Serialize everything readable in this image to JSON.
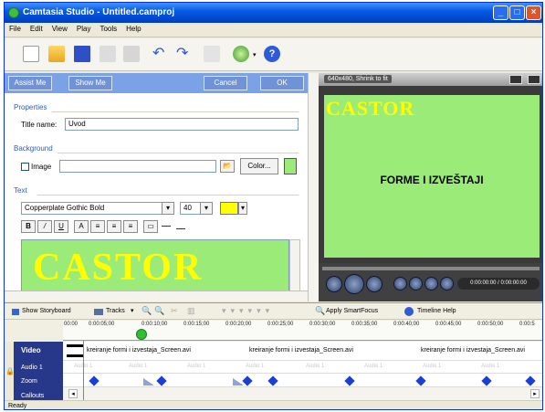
{
  "window": {
    "title": "Camtasia Studio - Untitled.camproj"
  },
  "menu": [
    "File",
    "Edit",
    "View",
    "Play",
    "Tools",
    "Help"
  ],
  "toolbar": {
    "icons": [
      "new-icon",
      "open-folder-icon",
      "save-icon",
      "import-icon",
      "produce-icon",
      "undo-icon",
      "redo-icon",
      "cut-icon",
      "record-icon",
      "help-icon"
    ]
  },
  "panel": {
    "assist_label": "Assist Me",
    "show_label": "Show Me",
    "cancel_label": "Cancel",
    "ok_label": "OK",
    "properties_heading": "Properties",
    "title_name_label": "Title name:",
    "title_name_value": "Uvod",
    "background_heading": "Background",
    "image_label": "Image",
    "color_button": "Color...",
    "text_heading": "Text",
    "font_value": "Copperplate Gothic Bold",
    "font_size": "40",
    "preview_text": "CASTOR"
  },
  "preview": {
    "resolution_label": "640x480, Shrink to fit",
    "logo_text": "CASTOR",
    "caption": "FORME I IZVEŠTAJI",
    "time_display": "0:00:00:00 / 0:00:00:00",
    "background_color": "#9aeb77"
  },
  "timeline": {
    "storyboard_label": "Show Storyboard",
    "tracks_label": "Tracks",
    "smartfocus_label": "Apply SmartFocus",
    "help_label": "Timeline Help",
    "ruler": [
      "00:00",
      "0:00:05;00",
      "0:00:10;00",
      "0:00:15;00",
      "0:00:20;00",
      "0:00:25;00",
      "0:00:30;00",
      "0:00:35;00",
      "0:00:40;00",
      "0:00:45;00",
      "0:00:50;00",
      "0:00:5"
    ],
    "tracks": [
      "Video",
      "Audio 1",
      "Zoom",
      "Callouts"
    ],
    "clips": [
      "kreiranje formi i izvestaja_Screen.avi",
      "kreiranje formi i izvestaja_Screen.avi",
      "kreiranje formi i izvestaja_Screen.avi"
    ],
    "audio_labels": [
      "Audio 1",
      "Audio 1",
      "Audio 1",
      "Audio 1",
      "Audio 1",
      "Audio 1",
      "Audio 1",
      "Audio 1"
    ]
  },
  "status": {
    "text": "Ready"
  }
}
